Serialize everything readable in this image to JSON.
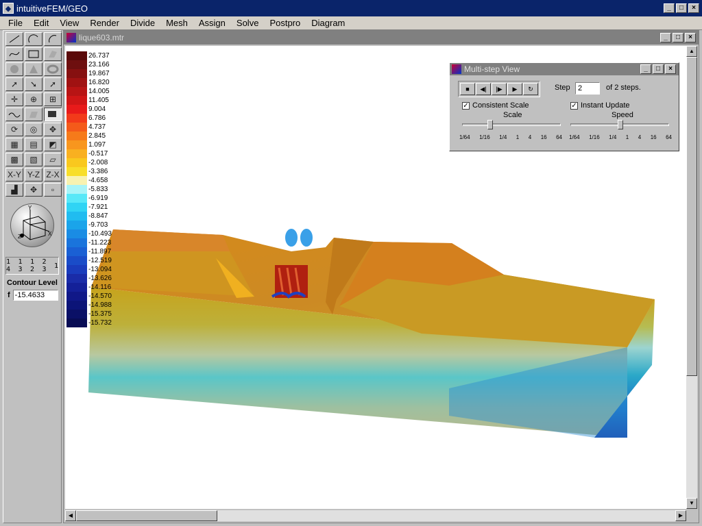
{
  "app": {
    "title": "intuitiveFEM/GEO"
  },
  "menu": [
    "File",
    "Edit",
    "View",
    "Render",
    "Divide",
    "Mesh",
    "Assign",
    "Solve",
    "Postpro",
    "Diagram"
  ],
  "document": {
    "title": "lique603.mtr"
  },
  "toolbox": {
    "axis_labels": [
      "1 4",
      "1 3",
      "1 2",
      "2 3",
      "1"
    ],
    "contour_label": "Contour Level",
    "f_label": "f",
    "f_value": "-15.4633",
    "plane_labels": [
      "X-Y",
      "Y-Z",
      "Z-X"
    ]
  },
  "legend": {
    "values": [
      "26.737",
      "23.166",
      "19.867",
      "16.820",
      "14.005",
      "11.405",
      "9.004",
      "6.786",
      "4.737",
      "2.845",
      "1.097",
      "-0.517",
      "-2.008",
      "-3.386",
      "-4.658",
      "-5.833",
      "-6.919",
      "-7.921",
      "-8.847",
      "-9.703",
      "-10.493",
      "-11.223",
      "-11.897",
      "-12.519",
      "-13.094",
      "-13.626",
      "-14.116",
      "-14.570",
      "-14.988",
      "-15.375",
      "-15.732"
    ],
    "colors": [
      "#5a0a0a",
      "#6e0f0f",
      "#861010",
      "#a01212",
      "#b81414",
      "#d01616",
      "#e81a1a",
      "#f23a1a",
      "#f45a1a",
      "#f67a1a",
      "#f8961e",
      "#f9b020",
      "#f9c81e",
      "#f8de2a",
      "#f8f2b0",
      "#a8f4f8",
      "#58e8f8",
      "#30d4f4",
      "#20bcf0",
      "#1aa4ea",
      "#1a8ce4",
      "#1a74dc",
      "#1a60d4",
      "#1a4cc8",
      "#1a3cbc",
      "#1a2ca8",
      "#142098",
      "#101888",
      "#0c1478",
      "#0a1066",
      "#080c54"
    ]
  },
  "multistep": {
    "title": "Multi-step View",
    "step_label": "Step",
    "step_value": "2",
    "step_total": "of 2 steps.",
    "consistent_scale": "Consistent Scale",
    "instant_update": "Instant Update",
    "scale_label": "Scale",
    "speed_label": "Speed",
    "ticks": [
      "1/64",
      "1/16",
      "1/4",
      "1",
      "4",
      "16",
      "64"
    ]
  }
}
